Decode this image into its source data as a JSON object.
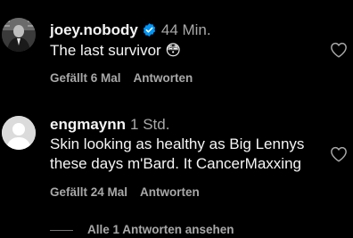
{
  "comments": [
    {
      "username": "joey.nobody",
      "verified": true,
      "time": "44 Min.",
      "text": "The last survivor 😳",
      "likes": "Gefällt 6 Mal",
      "reply_label": "Antworten"
    },
    {
      "username": "engmaynn",
      "verified": false,
      "time": "1 Std.",
      "text": "Skin looking as healthy as Big Lennys these days m'Bard. It CancerMaxxing",
      "likes": "Gefällt 24 Mal",
      "reply_label": "Antworten"
    }
  ],
  "view_replies": "Alle 1 Antworten ansehen",
  "colors": {
    "background": "#000000",
    "primary_text": "#f5f5f5",
    "secondary_text": "#a8a8a8",
    "verified_badge": "#0095f6"
  },
  "icons": {
    "like": "heart-outline-icon",
    "verified": "verified-badge-icon"
  }
}
